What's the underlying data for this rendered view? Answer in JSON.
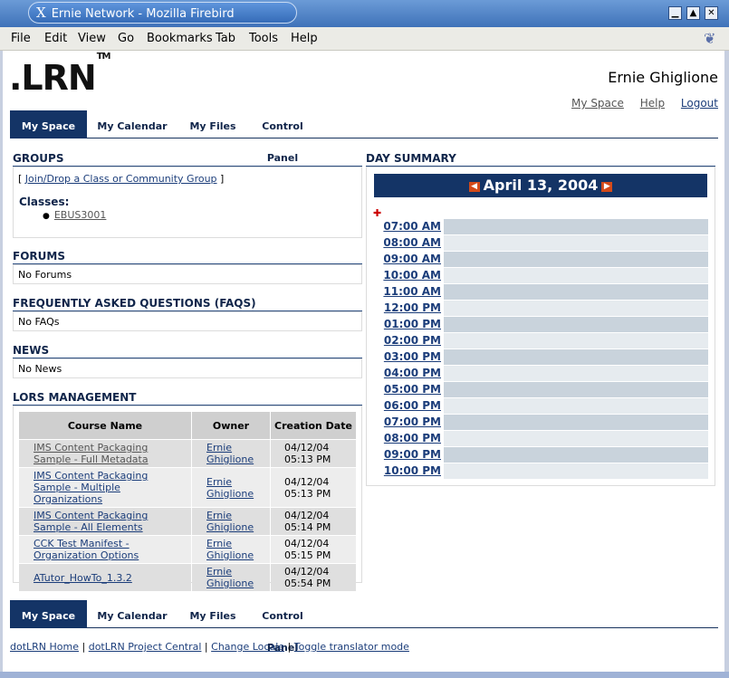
{
  "window": {
    "title": "Ernie Network - Mozilla Firebird"
  },
  "menu": [
    "File",
    "Edit",
    "View",
    "Go",
    "Bookmarks",
    "Tab",
    "Tools",
    "Help"
  ],
  "header": {
    "logo": ".LRN",
    "logo_tm": "TM",
    "user_name": "Ernie Ghiglione",
    "links": [
      "My Space",
      "Help",
      "Logout"
    ]
  },
  "tabs": [
    "My Space",
    "My Calendar",
    "My Files",
    "Control Panel"
  ],
  "groups": {
    "title": "GROUPS",
    "join_prefix": "[ ",
    "join_link": "Join/Drop a Class or Community Group",
    "join_suffix": " ]",
    "classes_label": "Classes:",
    "class_item": "EBUS3001"
  },
  "forums": {
    "title": "FORUMS",
    "text": "No Forums"
  },
  "faqs": {
    "title": "FREQUENTLY ASKED QUESTIONS (FAQS)",
    "text": "No FAQs"
  },
  "news": {
    "title": "NEWS",
    "text": "No News"
  },
  "lors": {
    "title": "LORS MANAGEMENT",
    "columns": [
      "Course Name",
      "Owner",
      "Creation Date"
    ],
    "rows": [
      {
        "course": "IMS Content Packaging Sample - Full Metadata",
        "owner": "Ernie Ghiglione",
        "date": "04/12/04 05:13 PM"
      },
      {
        "course": "IMS Content Packaging Sample - Multiple Organizations",
        "owner": "Ernie Ghiglione",
        "date": "04/12/04 05:13 PM"
      },
      {
        "course": "IMS Content Packaging Sample - All Elements",
        "owner": "Ernie Ghiglione",
        "date": "04/12/04 05:14 PM"
      },
      {
        "course": "CCK Test Manifest - Organization Options",
        "owner": "Ernie Ghiglione",
        "date": "04/12/04 05:15 PM"
      },
      {
        "course": "ATutor_HowTo_1.3.2",
        "owner": "Ernie Ghiglione",
        "date": "04/12/04 05:54 PM"
      }
    ]
  },
  "day_summary": {
    "title": "DAY SUMMARY",
    "date": "April 13, 2004",
    "hours": [
      "07:00 AM",
      "08:00 AM",
      "09:00 AM",
      "10:00 AM",
      "11:00 AM",
      "12:00 PM",
      "01:00 PM",
      "02:00 PM",
      "03:00 PM",
      "04:00 PM",
      "05:00 PM",
      "06:00 PM",
      "07:00 PM",
      "08:00 PM",
      "09:00 PM",
      "10:00 PM"
    ]
  },
  "footer": [
    "dotLRN Home",
    "dotLRN Project Central",
    "Change Locale",
    "Toggle translator mode"
  ],
  "colors": {
    "navy": "#143466",
    "row_dark": "#c9d3dc",
    "row_light": "#e6ebef"
  }
}
